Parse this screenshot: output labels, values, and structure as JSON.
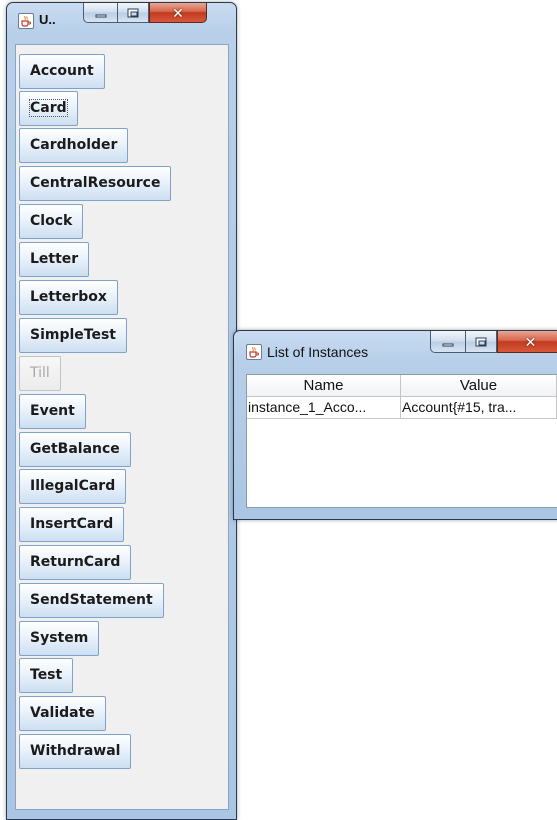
{
  "main_window": {
    "title": "U..",
    "buttons": [
      {
        "label": "Account"
      },
      {
        "label": "Card",
        "focused": true
      },
      {
        "label": "Cardholder"
      },
      {
        "label": "CentralResource"
      },
      {
        "label": "Clock"
      },
      {
        "label": "Letter"
      },
      {
        "label": "Letterbox"
      },
      {
        "label": "SimpleTest"
      },
      {
        "label": "Till",
        "disabled": true
      },
      {
        "label": "Event"
      },
      {
        "label": "GetBalance"
      },
      {
        "label": "IllegalCard"
      },
      {
        "label": "InsertCard"
      },
      {
        "label": "ReturnCard"
      },
      {
        "label": "SendStatement"
      },
      {
        "label": "System"
      },
      {
        "label": "Test"
      },
      {
        "label": "Validate"
      },
      {
        "label": "Withdrawal"
      }
    ]
  },
  "instances_window": {
    "title": "List of Instances",
    "table": {
      "columns": [
        "Name",
        "Value"
      ],
      "rows": [
        [
          "instance_1_Acco...",
          "Account{#15, tra..."
        ]
      ]
    }
  },
  "icons": {
    "app": "java-cup-icon",
    "minimize": "minimize-icon",
    "maximize": "maximize-icon",
    "close": "close-icon"
  },
  "colors": {
    "frame": "#b7cfe9",
    "close_button": "#c94a2e",
    "button_border": "#7ea2c8"
  }
}
